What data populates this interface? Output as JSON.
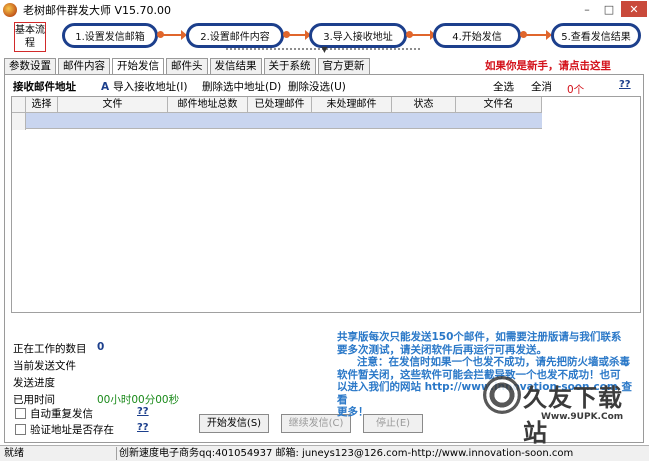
{
  "window": {
    "title": "老树邮件群发大师 V15.70.00"
  },
  "steps": {
    "basic_label": "基本流程",
    "items": [
      "1.设置发信邮箱",
      "2.设置邮件内容",
      "3.导入接收地址",
      "4.开始发信",
      "5.查看发信结果"
    ]
  },
  "tabs": [
    "参数设置",
    "邮件内容",
    "开始发信",
    "邮件头",
    "发信结果",
    "关于系统",
    "官方更新"
  ],
  "active_tab": "开始发信",
  "newbie_link": "如果你是新手，请点击这里",
  "toolbar": {
    "title": "接收邮件地址",
    "import": "导入接收地址(I)",
    "delete_selected": "删除选中地址(D)",
    "delete_unselected": "删除没选(U)",
    "select_all": "全选",
    "deselect_all": "全消",
    "help": "??"
  },
  "selected_count": "0个",
  "grid": {
    "columns": [
      "选择",
      "文件",
      "邮件地址总数",
      "已处理邮件",
      "未处理邮件",
      "状态",
      "文件名"
    ]
  },
  "stats": {
    "working_label": "正在工作的数目",
    "working_value": "0",
    "current_file_label": "当前发送文件",
    "progress_label": "发送进度",
    "elapsed_label": "已用时间",
    "elapsed_value": "00小时00分00秒"
  },
  "checkboxes": {
    "auto_repeat": "自动重复发信",
    "verify_address": "验证地址是否存在",
    "help": "??"
  },
  "buttons": {
    "start": "开始发信(S)",
    "resume": "继续发信(C)",
    "stop": "停止(E)"
  },
  "notice": {
    "line1": "共享版每次只能发送150个邮件，如需要注册版请与我们联系",
    "line2": "要多次测试，请关闭软件后再运行可再发送。",
    "line3": "注意：在发信时如果一个也发不成功，请先把防火墙或杀毒",
    "line4": "软件暂关闭，这些软件可能会拦截导致一个也发不成功！也可",
    "line5": "以进入我们的网站 http://www.innovation-soon.com 查看",
    "line6": "更多！"
  },
  "watermark": {
    "text": "久友下载站",
    "sub": "Www.9UPK.Com"
  },
  "statusbar": {
    "state": "就绪",
    "contact": "创新速度电子商务qq:401054937 邮箱: juneys123@126.com-http://www.innovation-soon.com"
  },
  "colors": {
    "step_border": "#1c3f8c",
    "arrow": "#e0662c",
    "link_red": "#d3111a",
    "notice_blue": "#2a78c8",
    "selected_row": "#c9d5ef"
  }
}
